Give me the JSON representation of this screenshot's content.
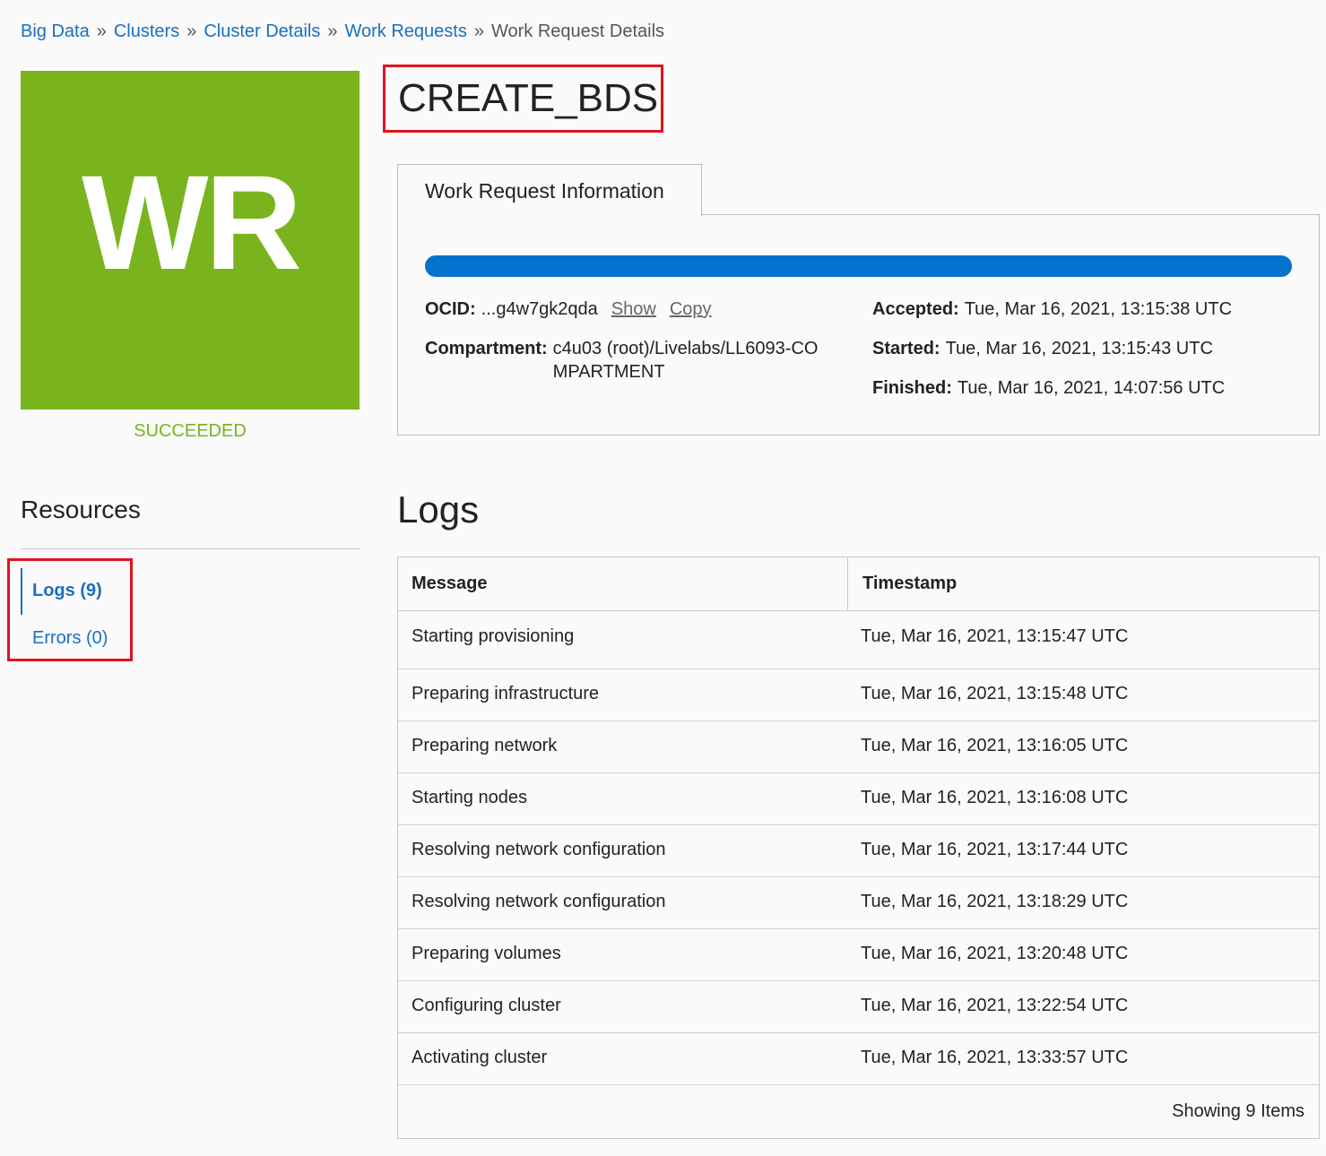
{
  "breadcrumb": {
    "items": [
      "Big Data",
      "Clusters",
      "Cluster Details",
      "Work Requests"
    ],
    "separator": "»",
    "current": "Work Request Details"
  },
  "badge": {
    "initials": "WR",
    "status": "SUCCEEDED",
    "color": "#79b41e"
  },
  "title": "CREATE_BDS",
  "info": {
    "tab_label": "Work Request Information",
    "progress_fraction": 1.0,
    "ocid_label": "OCID:",
    "ocid_value": "...g4w7gk2qda",
    "show_link": "Show",
    "copy_link": "Copy",
    "compartment_label": "Compartment:",
    "compartment_value": "c4u03 (root)/Livelabs/LL6093-COMPARTMENT",
    "accepted_label": "Accepted:",
    "accepted_value": "Tue, Mar 16, 2021, 13:15:38 UTC",
    "started_label": "Started:",
    "started_value": "Tue, Mar 16, 2021, 13:15:43 UTC",
    "finished_label": "Finished:",
    "finished_value": "Tue, Mar 16, 2021, 14:07:56 UTC"
  },
  "resources": {
    "title": "Resources",
    "items": [
      {
        "label": "Logs (9)",
        "active": true
      },
      {
        "label": "Errors (0)",
        "active": false
      }
    ]
  },
  "logs": {
    "title": "Logs",
    "columns": [
      "Message",
      "Timestamp"
    ],
    "rows": [
      {
        "message": "Starting provisioning",
        "timestamp": "Tue, Mar 16, 2021, 13:15:47 UTC"
      },
      {
        "message": "Preparing infrastructure",
        "timestamp": "Tue, Mar 16, 2021, 13:15:48 UTC"
      },
      {
        "message": "Preparing network",
        "timestamp": "Tue, Mar 16, 2021, 13:16:05 UTC"
      },
      {
        "message": "Starting nodes",
        "timestamp": "Tue, Mar 16, 2021, 13:16:08 UTC"
      },
      {
        "message": "Resolving network configuration",
        "timestamp": "Tue, Mar 16, 2021, 13:17:44 UTC"
      },
      {
        "message": "Resolving network configuration",
        "timestamp": "Tue, Mar 16, 2021, 13:18:29 UTC"
      },
      {
        "message": "Preparing volumes",
        "timestamp": "Tue, Mar 16, 2021, 13:20:48 UTC"
      },
      {
        "message": "Configuring cluster",
        "timestamp": "Tue, Mar 16, 2021, 13:22:54 UTC"
      },
      {
        "message": "Activating cluster",
        "timestamp": "Tue, Mar 16, 2021, 13:33:57 UTC"
      }
    ],
    "footer": "Showing 9 Items"
  }
}
